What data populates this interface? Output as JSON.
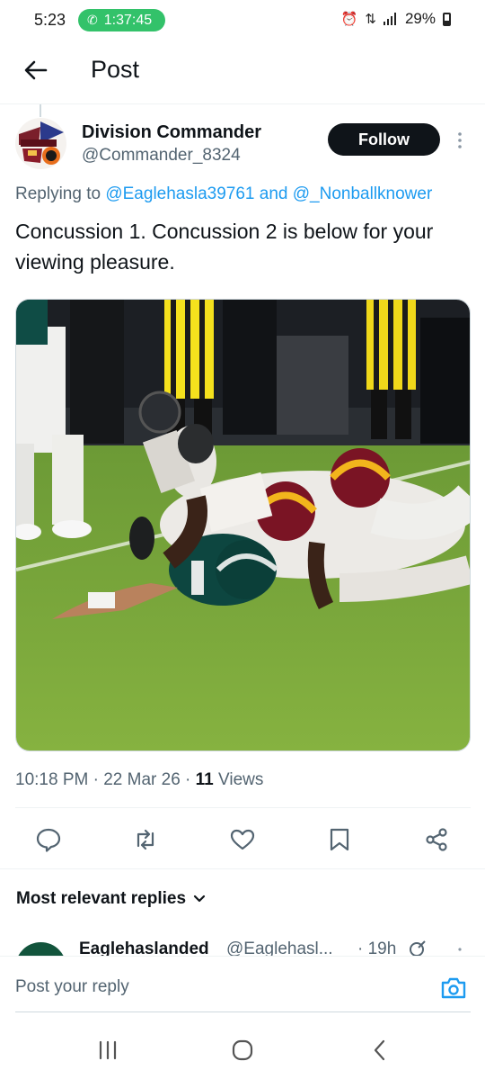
{
  "status_bar": {
    "time": "5:23",
    "call_timer": "1:37:45",
    "battery": "29%",
    "call_color": "#33c26a"
  },
  "topbar": {
    "title": "Post",
    "back_icon": "arrow-left-icon"
  },
  "post": {
    "author": {
      "name": "Division Commander",
      "handle": "@Commander_8324"
    },
    "follow_label": "Follow",
    "replying_prefix": "Replying to",
    "replying_handle_1": "@Eaglehasla39761",
    "replying_and": "and",
    "replying_handle_2": "@_Nonballknower",
    "text": "Concussion 1. Concussion 2 is below for your viewing pleasure.",
    "media_description_icon": "photo-icon",
    "time": "10:18 PM",
    "date": "22 Mar 26",
    "views_count": "11",
    "views_label": "Views",
    "separator": "·"
  },
  "actions": {
    "reply": "reply-icon",
    "repost": "repost-icon",
    "like": "heart-icon",
    "bookmark": "bookmark-icon",
    "share": "share-icon"
  },
  "replies": {
    "sort_label": "Most relevant replies",
    "first_reply": {
      "name": "Eaglehaslanded",
      "handle": "@Eaglehasl...",
      "time": "· 19h"
    }
  },
  "composer": {
    "placeholder": "Post your reply"
  },
  "colors": {
    "accent": "#1d9bf0",
    "text_primary": "#0f1419",
    "text_secondary": "#536471",
    "follow_bg": "#0f1419"
  }
}
